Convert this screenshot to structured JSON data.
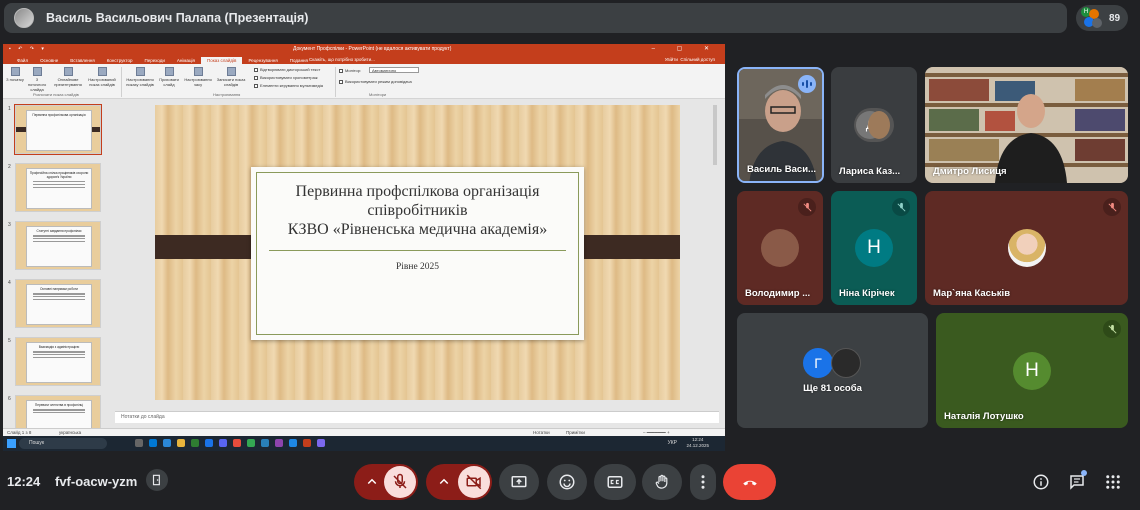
{
  "presenter": {
    "title": "Василь Васильович Палапа (Презентація)"
  },
  "participants": {
    "count": "89"
  },
  "powerpoint": {
    "window_title": "Документ Профспілки - PowerPoint (не вдалося активувати продукт)",
    "active_tab": "Показ слайдів",
    "tabs": [
      "Файл",
      "Основне",
      "Вставлення",
      "Конструктор",
      "Переходи",
      "Анімація",
      "Показ слайдів",
      "Рецензування",
      "Подання"
    ],
    "tell_me": "Скажіть, що потрібно зробити...",
    "signin": "Увійти",
    "share": "Спільний доступ",
    "ribbon_buttons": [
      "З початку",
      "З поточного слайда",
      "Онлайнове презентування",
      "Настроюваний показ слайдів",
      "Настроювання показу слайдів",
      "Приховати слайд",
      "Настроювання часу",
      "Записати показ слайдів"
    ],
    "ribbon_checks": [
      "Відтворювати дикторський текст",
      "Використовувати хронометраж",
      "Елементи керування мультимедіа"
    ],
    "ribbon_groups": [
      "Розпочати показ слайдів",
      "Настроювання",
      "Монітори"
    ],
    "monitor_label": "Монітор:",
    "monitor_value": "Автоматично",
    "presenter_view": "Використовувати режим доповідача",
    "slide": {
      "title_line1": "Первинна профспілкова організація",
      "title_line2": "співробітників",
      "title_line3": "КЗВО «Рівненська медична академія»",
      "subtitle": "Рівне 2025"
    },
    "thumbnails": [
      {
        "num": "1",
        "text": "Первинна профспілкова організація"
      },
      {
        "num": "2",
        "text": "Професійна спілка працівників охорони здоров'я України"
      },
      {
        "num": "3",
        "text": "Статутні завдання профспілки"
      },
      {
        "num": "4",
        "text": "Основні напрямки роботи"
      },
      {
        "num": "5",
        "text": "Взаємодія з адміністрацією"
      },
      {
        "num": "6",
        "text": "Переваги членства в профспілці"
      }
    ],
    "notes": "Нотатки до слайда",
    "status_slide": "Слайд 1 з 8",
    "status_lang": "українська",
    "status_notes": "Нотатки",
    "status_comments": "Примітки",
    "taskbar_search": "Пошук",
    "clock_time": "12:24",
    "clock_date": "24.12.2025",
    "clock_lang": "УКР"
  },
  "tiles": [
    {
      "name": "Василь Васи...",
      "state": "speaking"
    },
    {
      "name": "Лариса Каз...",
      "state": "video"
    },
    {
      "name": "Дмитро Лисиця",
      "state": "video"
    },
    {
      "name": "Володимир ...",
      "state": "muted"
    },
    {
      "name": "Ніна Кірічек",
      "letter": "Н",
      "state": "muted"
    },
    {
      "name": "Мар`яна Каськів",
      "state": "muted"
    },
    {
      "name": "Ще 81 особа",
      "letter": "Г"
    },
    {
      "name": "Наталія Лотушко",
      "letter": "Н",
      "state": "muted"
    }
  ],
  "meeting": {
    "time": "12:24",
    "code": "fvf-oacw-yzm"
  },
  "colors": {
    "accent_red": "#8c1d18",
    "hangup": "#ea4335",
    "powerpoint": "#c43e1c",
    "tile_teal": "#0b5c55",
    "tile_olive": "#3a5a1f",
    "tile_maroon": "#5e2a24"
  }
}
